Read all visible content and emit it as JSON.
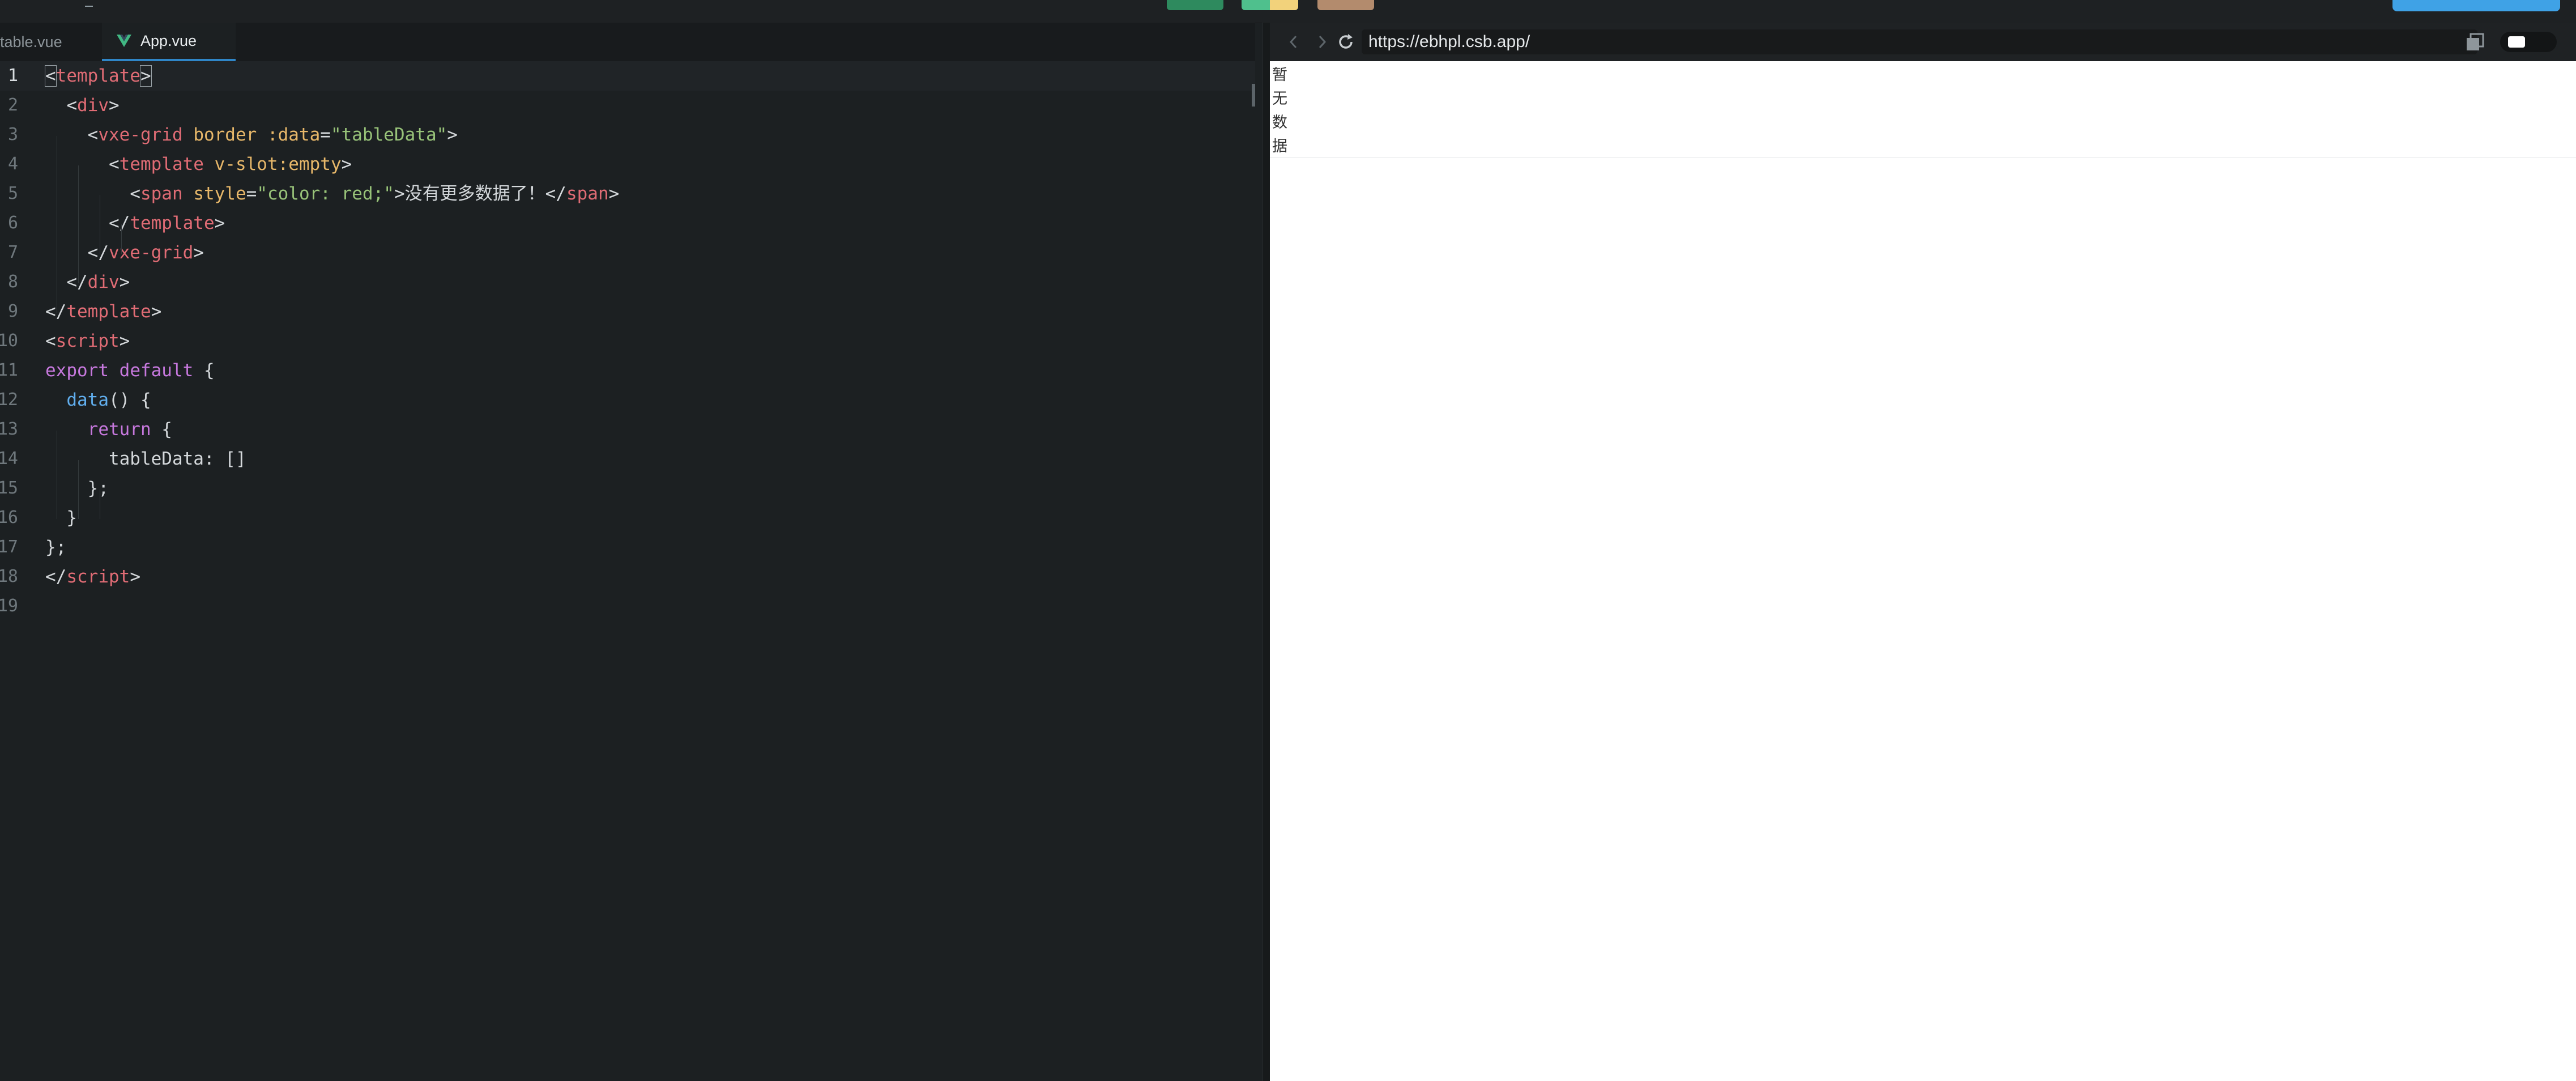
{
  "editor": {
    "tabs": [
      {
        "label": "table.vue",
        "active": false
      },
      {
        "label": "App.vue",
        "active": true
      }
    ],
    "lines": [
      {
        "n": "1",
        "parts": [
          [
            "br",
            "<"
          ],
          [
            "tag",
            "template"
          ],
          [
            "br",
            ">"
          ]
        ]
      },
      {
        "n": "2",
        "parts": [
          [
            "plain",
            "  "
          ],
          [
            "br",
            "<"
          ],
          [
            "tag",
            "div"
          ],
          [
            "br",
            ">"
          ]
        ]
      },
      {
        "n": "3",
        "parts": [
          [
            "plain",
            "    "
          ],
          [
            "br",
            "<"
          ],
          [
            "tag",
            "vxe-grid"
          ],
          [
            "plain",
            " "
          ],
          [
            "attr",
            "border"
          ],
          [
            "plain",
            " "
          ],
          [
            "attr",
            ":data"
          ],
          [
            "br",
            "="
          ],
          [
            "str",
            "\"tableData\""
          ],
          [
            "br",
            ">"
          ]
        ]
      },
      {
        "n": "4",
        "parts": [
          [
            "plain",
            "      "
          ],
          [
            "br",
            "<"
          ],
          [
            "tag",
            "template"
          ],
          [
            "plain",
            " "
          ],
          [
            "attr",
            "v-slot:empty"
          ],
          [
            "br",
            ">"
          ]
        ]
      },
      {
        "n": "5",
        "parts": [
          [
            "plain",
            "        "
          ],
          [
            "br",
            "<"
          ],
          [
            "tag",
            "span"
          ],
          [
            "plain",
            " "
          ],
          [
            "attr",
            "style"
          ],
          [
            "br",
            "="
          ],
          [
            "str",
            "\"color: red;\""
          ],
          [
            "br",
            ">"
          ],
          [
            "plain",
            "没有更多数据了！"
          ],
          [
            "br",
            "</"
          ],
          [
            "tag",
            "span"
          ],
          [
            "br",
            ">"
          ]
        ]
      },
      {
        "n": "6",
        "parts": [
          [
            "plain",
            "      "
          ],
          [
            "br",
            "</"
          ],
          [
            "tag",
            "template"
          ],
          [
            "br",
            ">"
          ]
        ]
      },
      {
        "n": "7",
        "parts": [
          [
            "plain",
            "    "
          ],
          [
            "br",
            "</"
          ],
          [
            "tag",
            "vxe-grid"
          ],
          [
            "br",
            ">"
          ]
        ]
      },
      {
        "n": "8",
        "parts": [
          [
            "plain",
            "  "
          ],
          [
            "br",
            "</"
          ],
          [
            "tag",
            "div"
          ],
          [
            "br",
            ">"
          ]
        ]
      },
      {
        "n": "9",
        "parts": [
          [
            "br",
            "</"
          ],
          [
            "tag",
            "template"
          ],
          [
            "br",
            ">"
          ]
        ]
      },
      {
        "n": "10",
        "parts": [
          [
            "br",
            "<"
          ],
          [
            "tag",
            "script"
          ],
          [
            "br",
            ">"
          ]
        ]
      },
      {
        "n": "11",
        "parts": [
          [
            "kw",
            "export"
          ],
          [
            "plain",
            " "
          ],
          [
            "kw",
            "default"
          ],
          [
            "plain",
            " {"
          ]
        ]
      },
      {
        "n": "12",
        "parts": [
          [
            "plain",
            "  "
          ],
          [
            "fn",
            "data"
          ],
          [
            "plain",
            "() {"
          ]
        ]
      },
      {
        "n": "13",
        "parts": [
          [
            "plain",
            "    "
          ],
          [
            "kw",
            "return"
          ],
          [
            "plain",
            " {"
          ]
        ]
      },
      {
        "n": "14",
        "parts": [
          [
            "plain",
            "      tableData: []"
          ]
        ]
      },
      {
        "n": "15",
        "parts": [
          [
            "plain",
            "    };"
          ]
        ]
      },
      {
        "n": "16",
        "parts": [
          [
            "plain",
            "  }"
          ]
        ]
      },
      {
        "n": "17",
        "parts": [
          [
            "plain",
            "};"
          ]
        ]
      },
      {
        "n": "18",
        "parts": [
          [
            "br",
            "</"
          ],
          [
            "tag",
            "script"
          ],
          [
            "br",
            ">"
          ]
        ]
      },
      {
        "n": "19",
        "parts": []
      }
    ]
  },
  "preview": {
    "url": "https://ebhpl.csb.app/",
    "empty_text": "暂无数据"
  },
  "icons": {
    "back": "chevron-left-icon",
    "forward": "chevron-right-icon",
    "reload": "refresh-icon",
    "open_new": "copy-window-icon",
    "vue": "vue-logo-icon"
  },
  "colors": {
    "tag": "#e06c75",
    "attr": "#e8b86a",
    "string": "#98c379",
    "keyword": "#c678dd",
    "function": "#61afef",
    "accent": "#3fa2e6"
  }
}
